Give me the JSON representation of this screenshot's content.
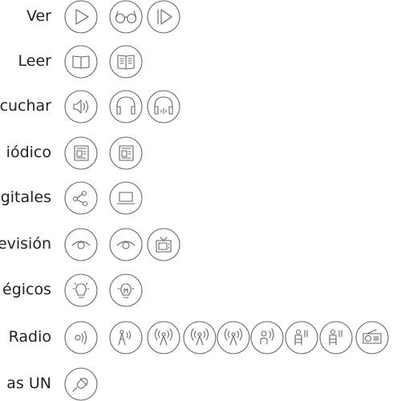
{
  "rows": [
    {
      "label": "Ver",
      "icons": [
        "play-icon",
        "glasses-icon",
        "step-play-icon"
      ]
    },
    {
      "label": "Leer",
      "icons": [
        "open-book-icon",
        "book-lines-icon"
      ]
    },
    {
      "label": "cuchar",
      "icons": [
        "speaker-icon",
        "headphones-icon",
        "headphones-wave-icon"
      ]
    },
    {
      "label": "iódico",
      "icons": [
        "newspaper-icon",
        "newspaper-icon"
      ]
    },
    {
      "label": "gitales",
      "icons": [
        "share-nodes-icon",
        "laptop-icon"
      ]
    },
    {
      "label": "evisión",
      "icons": [
        "eye-icon",
        "eye-icon",
        "tv-icon"
      ]
    },
    {
      "label": "égicos",
      "icons": [
        "lightbulb-icon",
        "lightbulb-filament-icon"
      ]
    },
    {
      "label": "Radio",
      "icons": [
        "radio-waves-icon",
        "antenna-icon",
        "broadcast-icon",
        "broadcast-icon",
        "broadcast-icon",
        "radio-person-icon",
        "tower-icon",
        "tower-icon",
        "radio-set-icon"
      ]
    },
    {
      "label": "as UN",
      "icons": [
        "microphone-icon"
      ]
    }
  ]
}
